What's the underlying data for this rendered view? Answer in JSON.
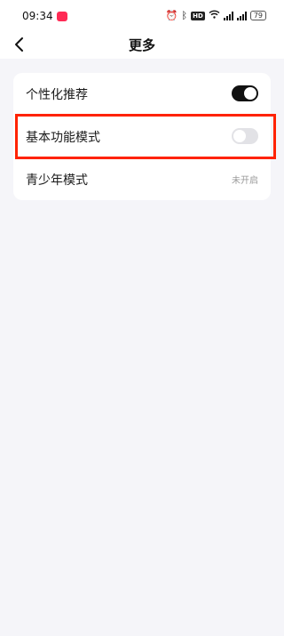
{
  "status_bar": {
    "time": "09:34",
    "hd_label": "HD",
    "battery": "79",
    "icons": [
      "app-notification-icon",
      "alarm-icon",
      "bluetooth-icon",
      "hd-icon",
      "wifi-icon",
      "signal-icon",
      "signal-icon",
      "battery-icon"
    ]
  },
  "header": {
    "title": "更多",
    "back_icon": "back-arrow-icon"
  },
  "settings": [
    {
      "label": "个性化推荐",
      "type": "toggle",
      "on": true
    },
    {
      "label": "基本功能模式",
      "type": "toggle",
      "on": false
    },
    {
      "label": "青少年模式",
      "type": "value",
      "value": "未开启"
    }
  ],
  "colors": {
    "background": "#f5f5f9",
    "toggle_on": "#111111",
    "toggle_off": "#e2e2e6",
    "highlight": "#ff2200",
    "secondary_text": "#9a9a9a"
  }
}
